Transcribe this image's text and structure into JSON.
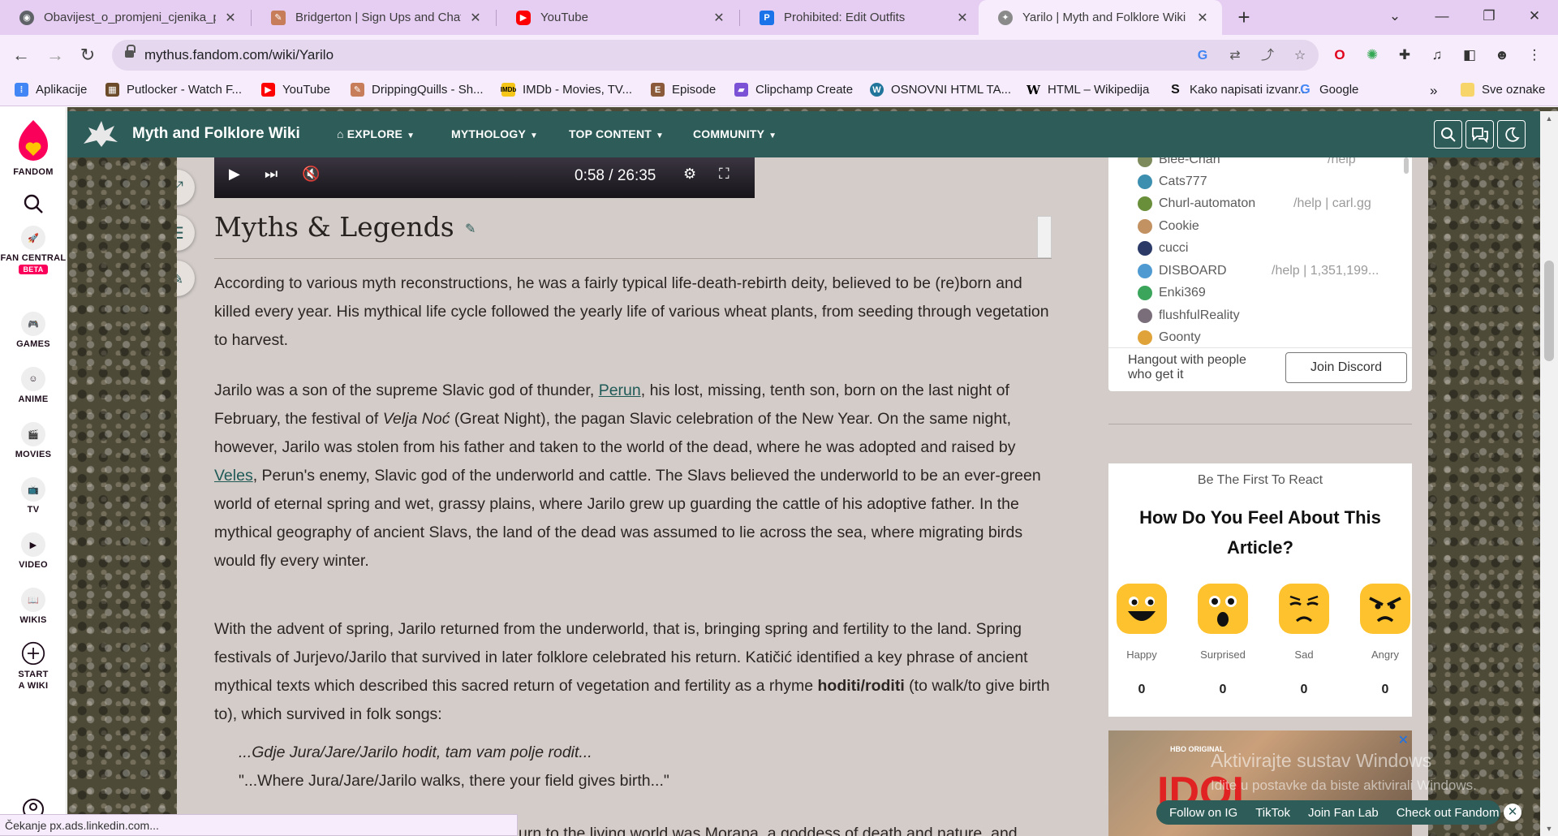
{
  "browser": {
    "tabs": [
      {
        "label": "Obavijest_o_promjeni_cjenika_p",
        "active": false,
        "icon": "chrome-icon"
      },
      {
        "label": "Bridgerton | Sign Ups and Chat",
        "active": false,
        "icon": "quill-icon"
      },
      {
        "label": "YouTube",
        "active": false,
        "icon": "youtube-icon"
      },
      {
        "label": "Prohibited: Edit Outfits",
        "active": false,
        "icon": "p-icon"
      },
      {
        "label": "Yarilo | Myth and Folklore Wiki |",
        "active": true,
        "icon": "wiki-icon"
      }
    ],
    "url": "mythus.fandom.com/wiki/Yarilo",
    "bookmarks": [
      {
        "label": "Aplikacije",
        "icon": "apps-grid-icon",
        "color": "#4285f4"
      },
      {
        "label": "Putlocker - Watch F...",
        "icon": "film-icon",
        "color": "#6b4b2a"
      },
      {
        "label": "YouTube",
        "icon": "youtube-icon",
        "color": "#ff0000"
      },
      {
        "label": "DrippingQuills - Sh...",
        "icon": "quill-icon",
        "color": "#c77d5a"
      },
      {
        "label": "IMDb - Movies, TV...",
        "icon": "imdb-icon",
        "color": "#f5c518"
      },
      {
        "label": "Episode",
        "icon": "episode-icon",
        "color": "#8a5a3a"
      },
      {
        "label": "Clipchamp Create",
        "icon": "clipchamp-icon",
        "color": "#7b52d6"
      },
      {
        "label": "OSNOVNI HTML TA...",
        "icon": "wordpress-icon",
        "color": "#21759b"
      },
      {
        "label": "HTML – Wikipedija",
        "icon": "wikipedia-icon",
        "color": "#000000"
      },
      {
        "label": "Kako napisati izvanr...",
        "icon": "s-icon",
        "color": "#111111"
      },
      {
        "label": "Google",
        "icon": "google-icon",
        "color": "#4285f4"
      },
      {
        "label": "Sve oznake",
        "icon": "folder-icon",
        "color": "#f7d56b"
      }
    ],
    "bookmarks_overflow": "»",
    "status": "Čekanje px.ads.linkedin.com..."
  },
  "fandom_rail": {
    "items": [
      {
        "label": "FANDOM",
        "icon": "fandom-heart-icon"
      },
      {
        "label": "",
        "icon": "search-icon"
      },
      {
        "label": "FAN CENTRAL",
        "icon": "rocket-icon",
        "badge": "BETA"
      },
      {
        "label": "GAMES",
        "icon": "gamepad-icon"
      },
      {
        "label": "ANIME",
        "icon": "anime-face-icon"
      },
      {
        "label": "MOVIES",
        "icon": "clapperboard-icon"
      },
      {
        "label": "TV",
        "icon": "tv-icon"
      },
      {
        "label": "VIDEO",
        "icon": "play-square-icon"
      },
      {
        "label": "WIKIS",
        "icon": "book-icon"
      },
      {
        "label": "START A WIKI",
        "icon": "plus-circle-icon"
      }
    ]
  },
  "wiki_header": {
    "name": "Myth and Folklore Wiki",
    "nav": [
      "EXPLORE",
      "MYTHOLOGY",
      "TOP CONTENT",
      "COMMUNITY"
    ],
    "accent": "#2d5c59"
  },
  "player": {
    "time": "0:58 / 26:35"
  },
  "article": {
    "heading": "Myths & Legends",
    "paragraphs": {
      "p1": "According to various myth reconstructions, he was a fairly typical life-death-rebirth deity, believed to be (re)born and killed every year. His mythical life cycle followed the yearly life of various wheat plants, from seeding through vegetation to harvest.",
      "p2a": "Jarilo was a son of the supreme Slavic god of thunder, ",
      "p2link1": "Perun",
      "p2b": ", his lost, missing, tenth son, born on the last night of February, the festival of ",
      "p2em": "Velja Noć",
      "p2c": " (Great Night), the pagan Slavic celebration of the New Year. On the same night, however, Jarilo was stolen from his father and taken to the world of the dead, where he was adopted and raised by ",
      "p2link2": "Veles",
      "p2d": ", Perun's enemy, Slavic god of the underworld and cattle. The Slavs believed the underworld to be an ever-green world of eternal spring and wet, grassy plains, where Jarilo grew up guarding the cattle of his adoptive father. In the mythical geography of ancient Slavs, the land of the dead was assumed to lie across the sea, where migrating birds would fly every winter.",
      "p3a": "With the advent of spring, Jarilo returned from the underworld, that is, bringing spring and fertility to the land. Spring festivals of Jurjevo/Jarilo that survived in later folklore celebrated his return. Katičić identified a key phrase of ancient mythical texts which described this sacred return of vegetation and fertility as a rhyme ",
      "p3b": "hoditi/roditi",
      "p3c": " (to walk/to give birth to), which survived in folk songs:",
      "quote1": "...Gdje Jura/Jare/Jarilo hodit, tam vam polje rodit...",
      "quote2": "\"...Where Jura/Jare/Jarilo walks, there your field gives birth...\"",
      "p4": "urn to the living world was Morana, a goddess of death and nature, and"
    }
  },
  "discord": {
    "members": [
      {
        "name": "Blee-Chan",
        "game": "/help",
        "color": "#7d8b5c"
      },
      {
        "name": "Cats777",
        "game": "",
        "color": "#3d8fb0"
      },
      {
        "name": "Churl-automaton",
        "game": "/help | carl.gg",
        "color": "#6a8f3a"
      },
      {
        "name": "Cookie",
        "game": "",
        "color": "#c29262"
      },
      {
        "name": "cucci",
        "game": "",
        "color": "#2b3a67"
      },
      {
        "name": "DISBOARD",
        "game": "/help | 1,351,199...",
        "color": "#4f9bd1"
      },
      {
        "name": "Enki369",
        "game": "",
        "color": "#3ba55c"
      },
      {
        "name": "flushfulReality",
        "game": "",
        "color": "#7a6e7a"
      },
      {
        "name": "Goonty",
        "game": "",
        "color": "#e0a33a"
      }
    ],
    "footer_text": "Hangout with people who get it",
    "join_label": "Join Discord"
  },
  "reactions": {
    "kicker": "Be The First To React",
    "question": "How Do You Feel About This Article?",
    "items": [
      {
        "label": "Happy",
        "count": "0",
        "icon": "happy-face-icon"
      },
      {
        "label": "Surprised",
        "count": "0",
        "icon": "surprised-face-icon"
      },
      {
        "label": "Sad",
        "count": "0",
        "icon": "sad-face-icon"
      },
      {
        "label": "Angry",
        "count": "0",
        "icon": "angry-face-icon"
      }
    ]
  },
  "ad": {
    "close": "✕",
    "hbo": "HBO ORIGINAL",
    "big": "IDOL"
  },
  "overlays": {
    "watermark_title": "Aktivirajte sustav Windows",
    "watermark_sub": "Idite u postavke da biste aktivirali Windows.",
    "fan_links": [
      "Follow on IG",
      "TikTok",
      "Join Fan Lab",
      "Check out Fandom"
    ]
  }
}
